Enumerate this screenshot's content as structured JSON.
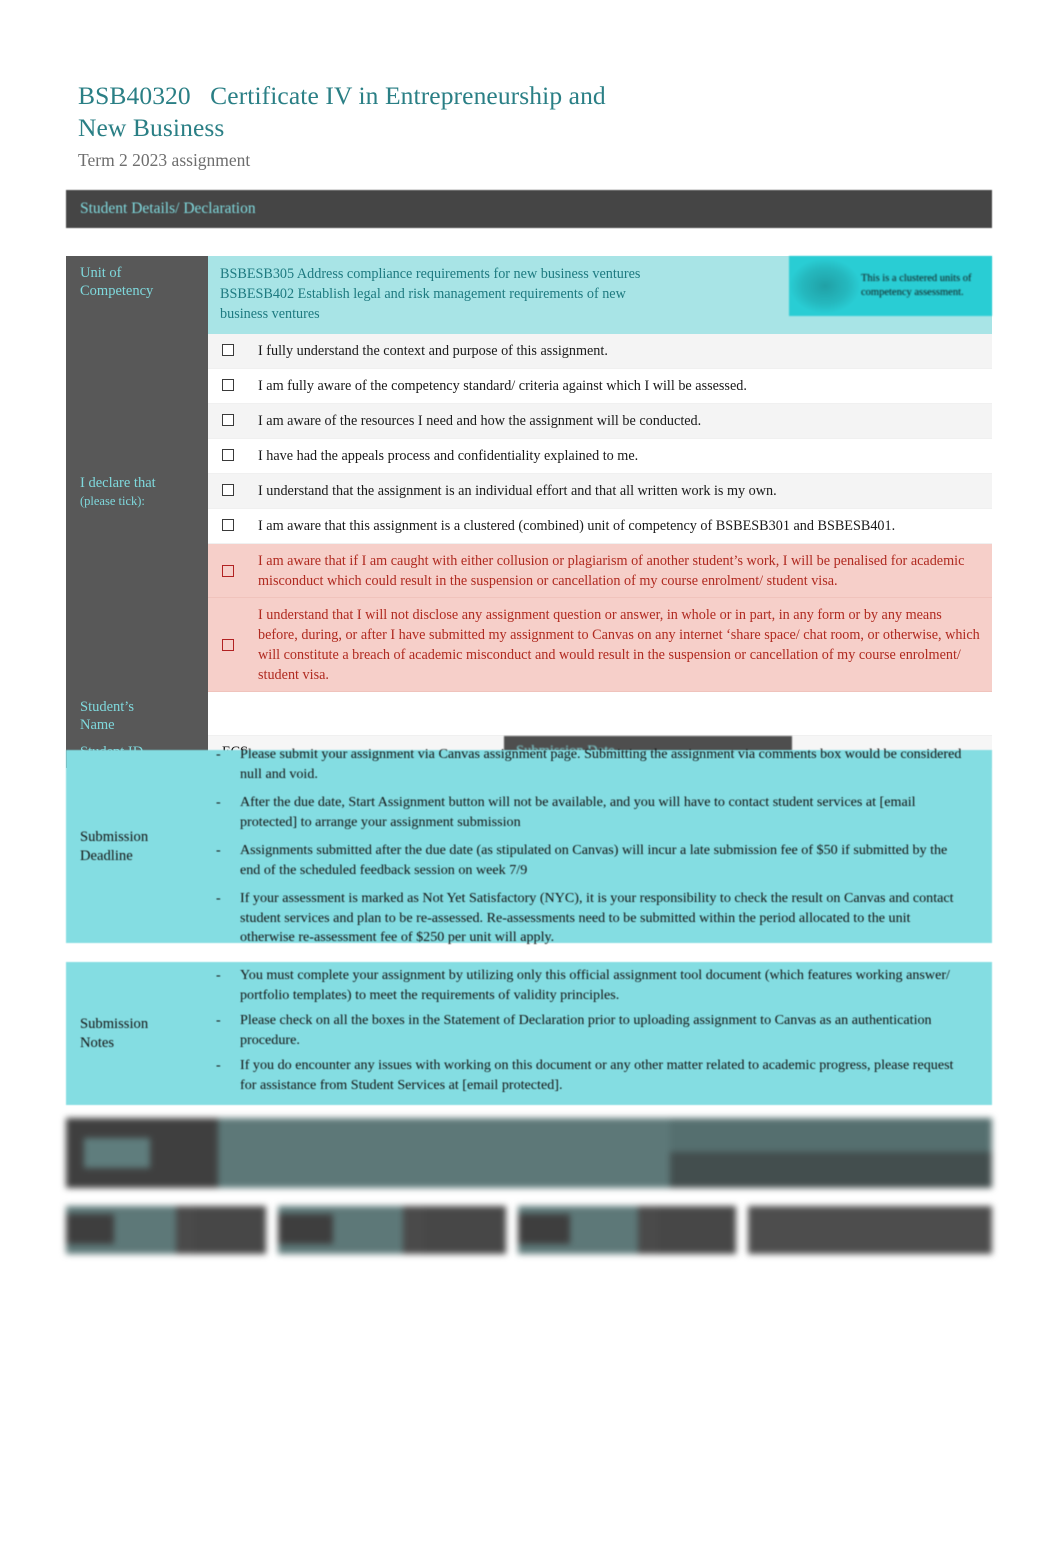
{
  "header": {
    "course_code": "BSB40320",
    "title": "BSB40320   Certificate IV in Entrepreneurship and\nNew Business",
    "subtitle": "Term 2 2023 assignment"
  },
  "section_bar": {
    "label": "Student Details/ Declaration"
  },
  "unit_of_competency": {
    "label": "Unit of\nCompetency",
    "lines": [
      "BSBESB305 Address compliance requirements for new business ventures",
      "BSBESB402 Establish legal and risk management requirements of new",
      "business ventures"
    ],
    "badge_text": "This is a clustered units of competency assessment.",
    "badge_icon": "cluster-icon"
  },
  "declaration": {
    "label_main": "I declare that",
    "label_sub": "(please tick):",
    "items": [
      {
        "text": "I fully understand the context and purpose of this assignment.",
        "warning": false,
        "checked": false
      },
      {
        "text": "I am fully aware of the competency standard/ criteria against which I will be assessed.",
        "warning": false,
        "checked": false
      },
      {
        "text": "I am aware of the resources I need and how the assignment will be conducted.",
        "warning": false,
        "checked": false
      },
      {
        "text": "I have had the appeals process and confidentiality explained to me.",
        "warning": false,
        "checked": false
      },
      {
        "text": "I understand that the assignment is an individual effort and that all written work is my own.",
        "warning": false,
        "checked": false
      },
      {
        "text": "I am aware that this assignment is a clustered (combined) unit of competency of BSBESB301 and BSBESB401.",
        "warning": false,
        "checked": false
      },
      {
        "text": "I am aware that if I am caught with either collusion or plagiarism of another student’s work, I will be penalised for academic misconduct which could result in the suspension or cancellation of my course enrolment/ student visa.",
        "warning": true,
        "checked": false
      },
      {
        "text": "I understand that I will not disclose any assignment question or answer, in whole or in part, in any form or by any means before, during, or after I have submitted my assignment to Canvas on any internet ‘share space/ chat room, or otherwise, which will constitute a breach of academic misconduct and would result in the suspension or cancellation of my course enrolment/ student visa.",
        "warning": true,
        "checked": false
      }
    ]
  },
  "student": {
    "name_label": "Student’s\nName",
    "name_value": "",
    "id_label": "Student ID",
    "id_value": "ECS",
    "submission_date_label": "Submission Date",
    "submission_date_value": ""
  },
  "submission_deadline": {
    "label": "Submission\nDeadline",
    "bullet_marker": "-",
    "bullets": [
      "Please submit your assignment via Canvas assignment page. Submitting the assignment via comments box would be considered null and void.",
      "After the due date, Start Assignment button will not be available, and you will have to contact student services at [email protected] to arrange your assignment submission",
      "Assignments submitted after the due date (as stipulated on Canvas) will incur a late submission fee of $50 if submitted by the end of the scheduled feedback session on week 7/9",
      "If your assessment is marked as Not Yet Satisfactory (NYC), it is your responsibility to check the result on Canvas and contact student services and plan to be re-assessed. Re-assessments need to be submitted within the period allocated to the unit otherwise re-assessment fee of $250 per unit will apply."
    ]
  },
  "submission_notes": {
    "label": "Submission\nNotes",
    "bullet_marker": "-",
    "bullets": [
      "You must   complete your assignment by utilizing only this official assignment tool document (which features working answer/ portfolio templates) to meet the requirements of validity principles.",
      "Please check on all the boxes        in the Statement of Declaration prior to uploading assignment to Canvas as an authentication procedure.",
      "If you do encounter any issues with working on this document or any other matter related to academic progress, please request for assistance from Student Services at [email protected]."
    ]
  },
  "redacted": {
    "note": "",
    "cells": [
      "",
      "",
      "",
      ""
    ]
  },
  "colors": {
    "teal_title": "#2a7f85",
    "teal_accent": "#7fd9dd",
    "turquoise_panel": "#84dde2",
    "turquoise_uoc": "#a8e4e6",
    "badge_cyan": "#29cdd4",
    "dark_label": "#585858",
    "section_bar": "#454545",
    "warning_bg": "#f6cfc9",
    "warning_text": "#b02a20",
    "body_text": "#1a1a1a",
    "subtitle_grey": "#6e6e6e"
  }
}
